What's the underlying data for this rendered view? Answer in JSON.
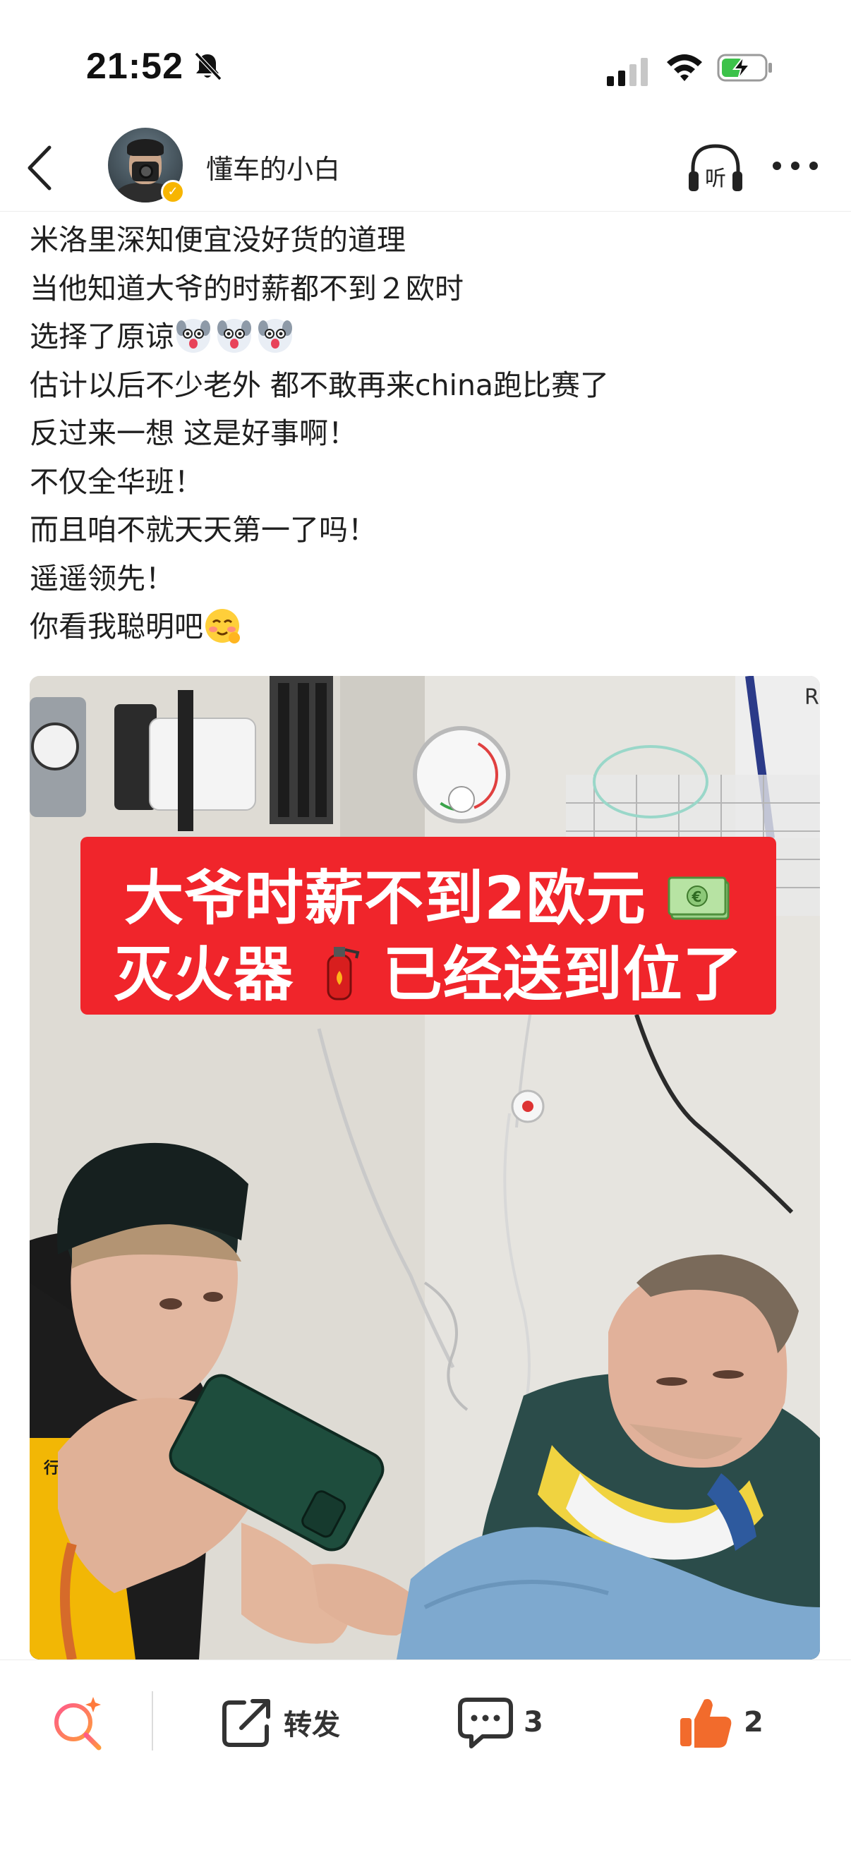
{
  "status_bar": {
    "time": "21:52",
    "icons": [
      "bell-slash-icon",
      "signal-icon",
      "wifi-icon",
      "battery-charging-icon"
    ]
  },
  "header": {
    "back_icon": "chevron-left-icon",
    "username": "懂车的小白",
    "verified": true,
    "listen_label": "听"
  },
  "post": {
    "lines": [
      "米洛里深知便宜没好货的道理",
      "当他知道大爷的时薪都不到２欧时",
      "选择了原谅",
      "估计以后不少老外 都不敢再来china跑比赛了",
      "反过来一想 这是好事啊！",
      "不仅全华班！",
      "而且咱不就天天第一了吗！",
      "遥遥领先！",
      "你看我聪明吧"
    ],
    "image": {
      "caption_line1": "大爷时薪不到2欧元",
      "caption_line2_a": "灭火器",
      "caption_line2_b": "已经送到位了",
      "corner_text": "R",
      "shirt_text": "行装备"
    }
  },
  "bottom_bar": {
    "repost_label": "转发",
    "comment_count": "3",
    "like_count": "2",
    "accent_color": "#f26b2c"
  }
}
